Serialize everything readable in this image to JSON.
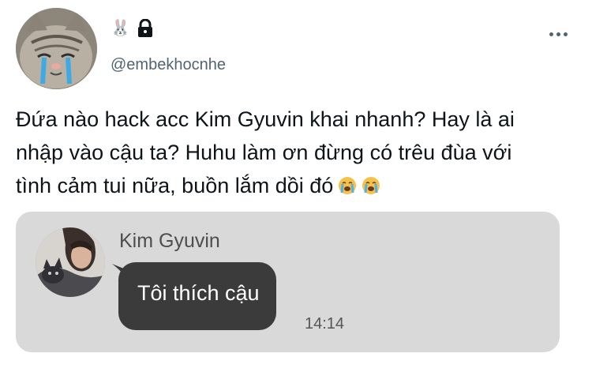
{
  "profile": {
    "handle": "@embekhocnhe",
    "name_icon": "bunny-emoji",
    "protected_icon": "lock-icon",
    "more_icon": "more-options-icon"
  },
  "tweet": {
    "text": "Đứa nào hack acc Kim Gyuvin khai nhanh? Hay là ai\nnhập vào cậu ta? Huhu làm ơn đừng có trêu đùa với\ntình cảm tui nữa, buồn lắm dồi đó",
    "emojis": [
      "crying-face-emoji",
      "crying-face-emoji"
    ]
  },
  "chat_card": {
    "sender": "Kim Gyuvin",
    "message": "Tôi thích cậu",
    "time": "14:14"
  },
  "colors": {
    "handle": "#536471",
    "card_bg": "#d9d9d9",
    "bubble_bg": "#3b3b3b",
    "bubble_text": "#ffffff"
  }
}
